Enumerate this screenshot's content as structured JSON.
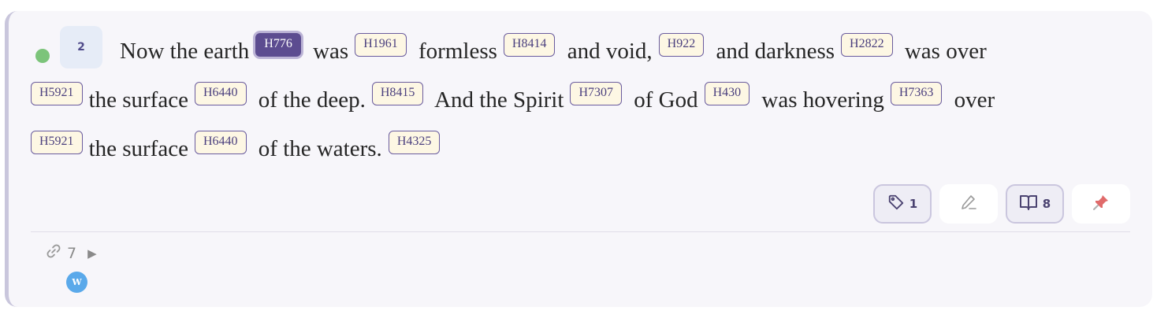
{
  "verse": {
    "number": "2",
    "segments": [
      {
        "text": "Now the earth",
        "tag": "H776",
        "active": true
      },
      {
        "text": "was",
        "tag": "H1961"
      },
      {
        "text": "formless",
        "tag": "H8414"
      },
      {
        "text": "and void,",
        "tag": "H922"
      },
      {
        "text": "and darkness",
        "tag": "H2822"
      },
      {
        "text": "was over",
        "tag": "H5921"
      },
      {
        "text": "the surface",
        "tag": "H6440"
      },
      {
        "text": "of the deep.",
        "tag": "H8415"
      },
      {
        "text": "And the Spirit",
        "tag": "H7307"
      },
      {
        "text": "of God",
        "tag": "H430"
      },
      {
        "text": "was hovering",
        "tag": "H7363"
      },
      {
        "text": "over",
        "tag": "H5921"
      },
      {
        "text": "the surface",
        "tag": "H6440"
      },
      {
        "text": "of the waters.",
        "tag": "H4325"
      }
    ]
  },
  "tools": {
    "tags_count": "1",
    "notes_count": "8"
  },
  "links": {
    "count": "7",
    "badge": "W"
  },
  "colors": {
    "status_dot": "#7cc47a",
    "tag_active": "#5c4c90",
    "tag_bg": "#fdf7e4",
    "pin": "#e06b6b",
    "badge": "#5aa9ea"
  },
  "icons": [
    "tag-icon",
    "pencil-icon",
    "book-icon",
    "pin-icon",
    "link-icon",
    "caret-right-icon"
  ]
}
